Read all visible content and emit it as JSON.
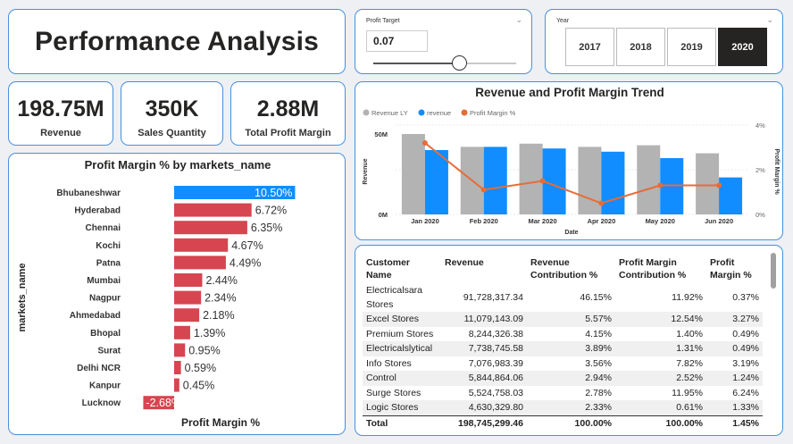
{
  "title": "Performance Analysis",
  "kpis": {
    "revenue": {
      "value": "198.75M",
      "label": "Revenue"
    },
    "sales_quantity": {
      "value": "350K",
      "label": "Sales Quantity"
    },
    "total_profit_margin": {
      "value": "2.88M",
      "label": "Total Profit Margin"
    }
  },
  "profit_target": {
    "title": "Profit Target",
    "value": "0.07",
    "slider_fraction": 0.6
  },
  "year_slicer": {
    "title": "Year",
    "options": [
      "2017",
      "2018",
      "2019",
      "2020"
    ],
    "selected": "2020"
  },
  "colors": {
    "accent": "#118dff",
    "negative_bar": "#d64550",
    "gray_bar": "#b3b3b3",
    "line": "#e66c37",
    "border": "#4a90d9"
  },
  "chart_data": [
    {
      "type": "bar",
      "title": "Profit Margin % by markets_name",
      "xlabel": "Profit Margin %",
      "ylabel": "markets_name",
      "categories": [
        "Bhubaneshwar",
        "Hyderabad",
        "Chennai",
        "Kochi",
        "Patna",
        "Mumbai",
        "Nagpur",
        "Ahmedabad",
        "Bhopal",
        "Surat",
        "Delhi NCR",
        "Kanpur",
        "Lucknow"
      ],
      "values": [
        10.5,
        6.72,
        6.35,
        4.67,
        4.49,
        2.44,
        2.34,
        2.18,
        1.39,
        0.95,
        0.59,
        0.45,
        -2.68
      ],
      "labels": [
        "10.50%",
        "6.72%",
        "6.35%",
        "4.67%",
        "4.49%",
        "2.44%",
        "2.34%",
        "2.18%",
        "1.39%",
        "0.95%",
        "0.59%",
        "0.45%",
        "-2.68%"
      ],
      "highlight": "Bhubaneshwar"
    },
    {
      "type": "bar",
      "title": "Revenue and Profit Margin Trend",
      "xlabel": "Date",
      "ylabel": "Revenue",
      "y2label": "Profit Margin %",
      "categories": [
        "Jan 2020",
        "Feb 2020",
        "Mar 2020",
        "Apr 2020",
        "May 2020",
        "Jun 2020"
      ],
      "y_ticks": [
        "0M",
        "50M"
      ],
      "y2_ticks": [
        "0%",
        "2%",
        "4%"
      ],
      "series": [
        {
          "name": "Revenue LY",
          "values": [
            50,
            42,
            44,
            42,
            43,
            38
          ]
        },
        {
          "name": "revenue",
          "values": [
            40,
            42,
            41,
            39,
            35,
            23
          ]
        },
        {
          "name": "Profit Margin %",
          "values": [
            3.2,
            1.1,
            1.5,
            0.5,
            1.3,
            1.3
          ]
        }
      ],
      "ylim": [
        0,
        60
      ],
      "y2lim": [
        0,
        4
      ]
    }
  ],
  "customer_table": {
    "headers": [
      "Customer Name",
      "Revenue",
      "Revenue Contribution %",
      "Profit Margin Contribution %",
      "Profit Margin %"
    ],
    "rows": [
      [
        "Electricalsara Stores",
        "91,728,317.34",
        "46.15%",
        "11.92%",
        "0.37%"
      ],
      [
        "Excel Stores",
        "11,079,143.09",
        "5.57%",
        "12.54%",
        "3.27%"
      ],
      [
        "Premium Stores",
        "8,244,326.38",
        "4.15%",
        "1.40%",
        "0.49%"
      ],
      [
        "Electricalslytical",
        "7,738,745.58",
        "3.89%",
        "1.31%",
        "0.49%"
      ],
      [
        "Info Stores",
        "7,076,983.39",
        "3.56%",
        "7.82%",
        "3.19%"
      ],
      [
        "Control",
        "5,844,864.06",
        "2.94%",
        "2.52%",
        "1.24%"
      ],
      [
        "Surge Stores",
        "5,524,758.03",
        "2.78%",
        "11.95%",
        "6.24%"
      ],
      [
        "Logic Stores",
        "4,630,329.80",
        "2.33%",
        "0.61%",
        "1.33%"
      ]
    ],
    "total": [
      "Total",
      "198,745,299.46",
      "100.00%",
      "100.00%",
      "1.45%"
    ]
  }
}
